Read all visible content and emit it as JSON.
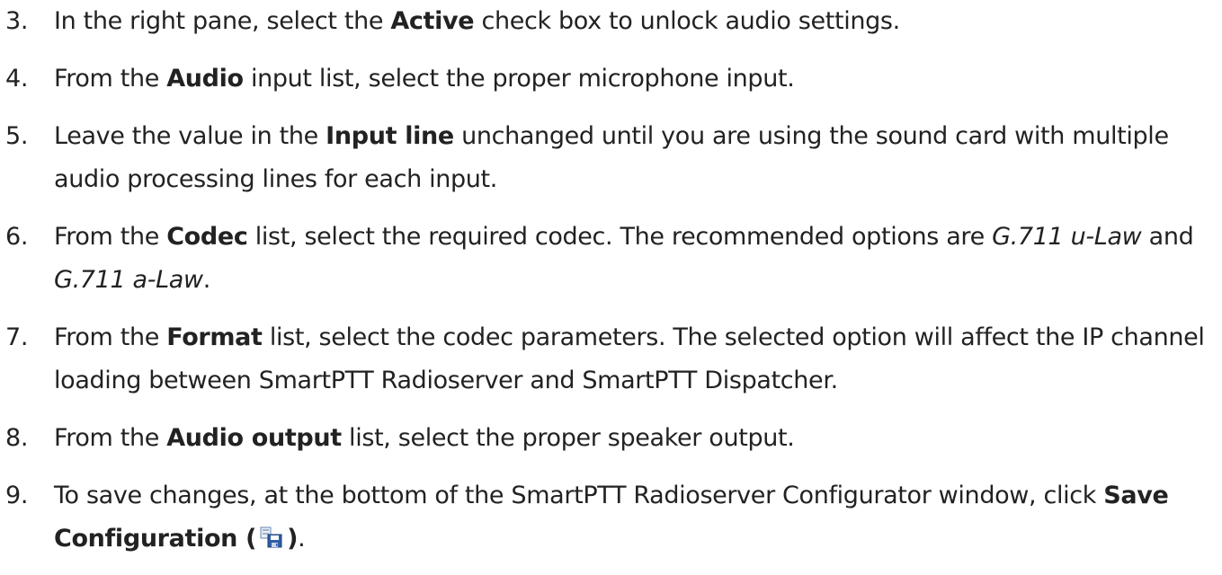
{
  "steps": [
    {
      "number": "3.",
      "parts": [
        {
          "t": "In the right pane, select the "
        },
        {
          "t": "Active",
          "b": true
        },
        {
          "t": " check box to unlock audio settings."
        }
      ]
    },
    {
      "number": "4.",
      "parts": [
        {
          "t": "From the "
        },
        {
          "t": "Audio",
          "b": true
        },
        {
          "t": " input list, select the proper microphone input."
        }
      ]
    },
    {
      "number": "5.",
      "parts": [
        {
          "t": "Leave the value in the "
        },
        {
          "t": "Input line",
          "b": true
        },
        {
          "t": " unchanged until you are using the sound card with multiple audio processing lines for each input."
        }
      ]
    },
    {
      "number": "6.",
      "parts": [
        {
          "t": "From the "
        },
        {
          "t": "Codec",
          "b": true
        },
        {
          "t": " list, select the required codec. The recommended options are "
        },
        {
          "t": "G.711 u-Law",
          "i": true
        },
        {
          "t": " and "
        },
        {
          "t": "G.711 a-Law",
          "i": true
        },
        {
          "t": "."
        }
      ]
    },
    {
      "number": "7.",
      "parts": [
        {
          "t": "From the "
        },
        {
          "t": "Format",
          "b": true
        },
        {
          "t": " list, select the codec parameters. The selected option will affect the IP channel loading between SmartPTT Radioserver and SmartPTT Dispatcher."
        }
      ]
    },
    {
      "number": "8.",
      "parts": [
        {
          "t": "From the "
        },
        {
          "t": "Audio output",
          "b": true
        },
        {
          "t": " list, select the proper speaker output."
        }
      ]
    },
    {
      "number": "9.",
      "parts": [
        {
          "t": "To save changes, at the bottom of the SmartPTT Radioserver Configurator window, click "
        },
        {
          "t": "Save Configuration (",
          "b": true
        },
        {
          "icon": "save-configuration-icon"
        },
        {
          "t": ")",
          "b": true
        },
        {
          "t": "."
        }
      ]
    }
  ]
}
